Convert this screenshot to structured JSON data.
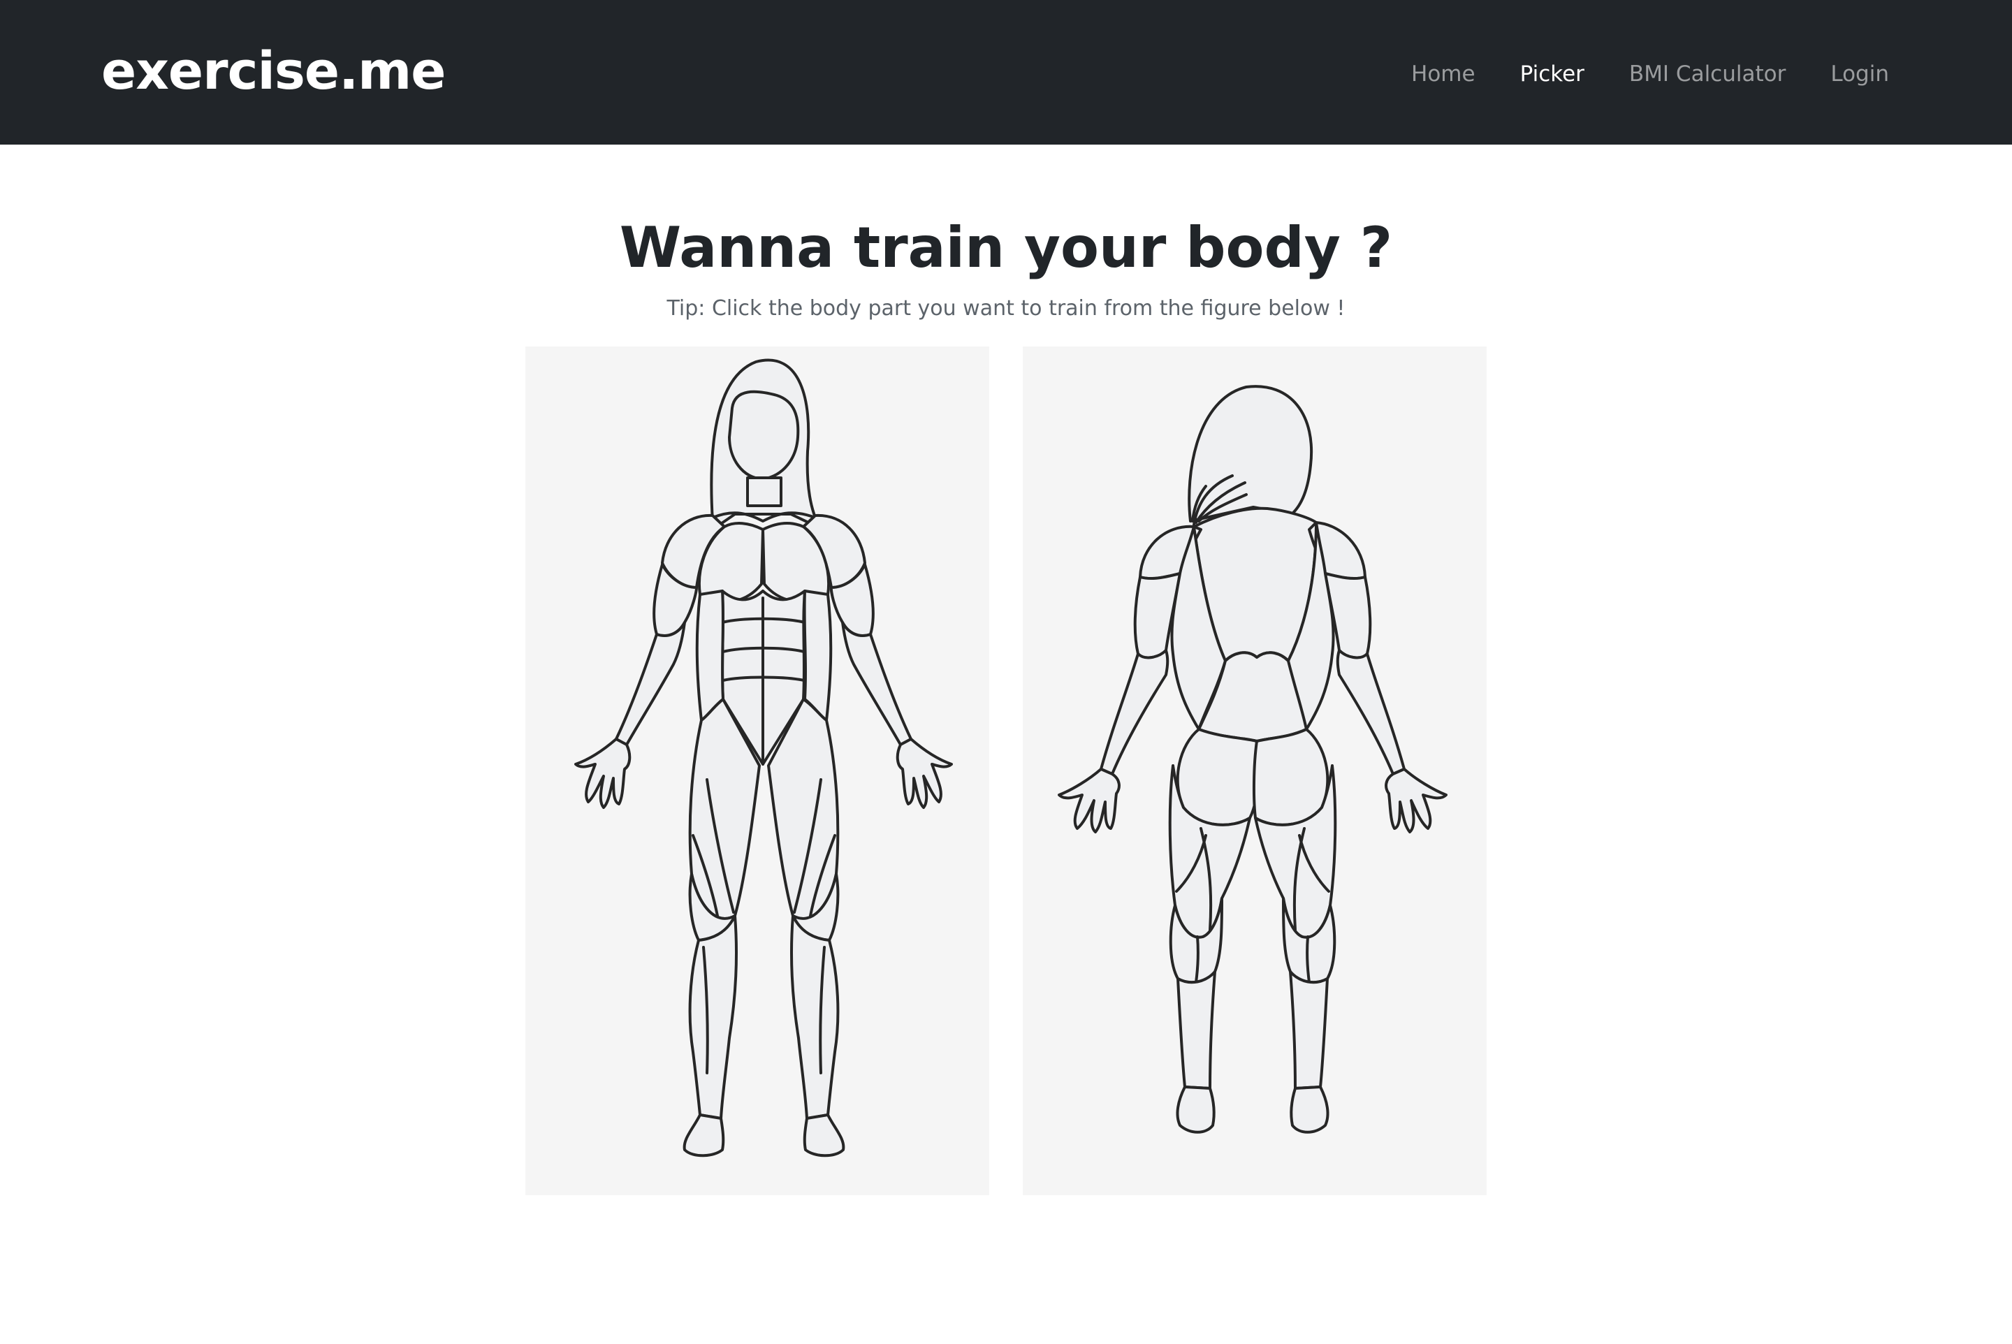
{
  "app": {
    "brand": "exercise.me"
  },
  "nav": {
    "items": [
      {
        "label": "Home",
        "active": false
      },
      {
        "label": "Picker",
        "active": true
      },
      {
        "label": "BMI Calculator",
        "active": false
      },
      {
        "label": "Login",
        "active": false
      }
    ]
  },
  "main": {
    "title": "Wanna train your body ?",
    "tip": "Tip: Click the body part you want to train from the figure below !"
  },
  "colors": {
    "navbar_bg": "#212529",
    "nav_active": "#ffffff",
    "nav_inactive": "#8a8c8e",
    "panel_bg": "#f5f5f5",
    "muscle_fill": "#eff0f2"
  },
  "figures": [
    {
      "name": "front-body-figure"
    },
    {
      "name": "back-body-figure"
    }
  ]
}
